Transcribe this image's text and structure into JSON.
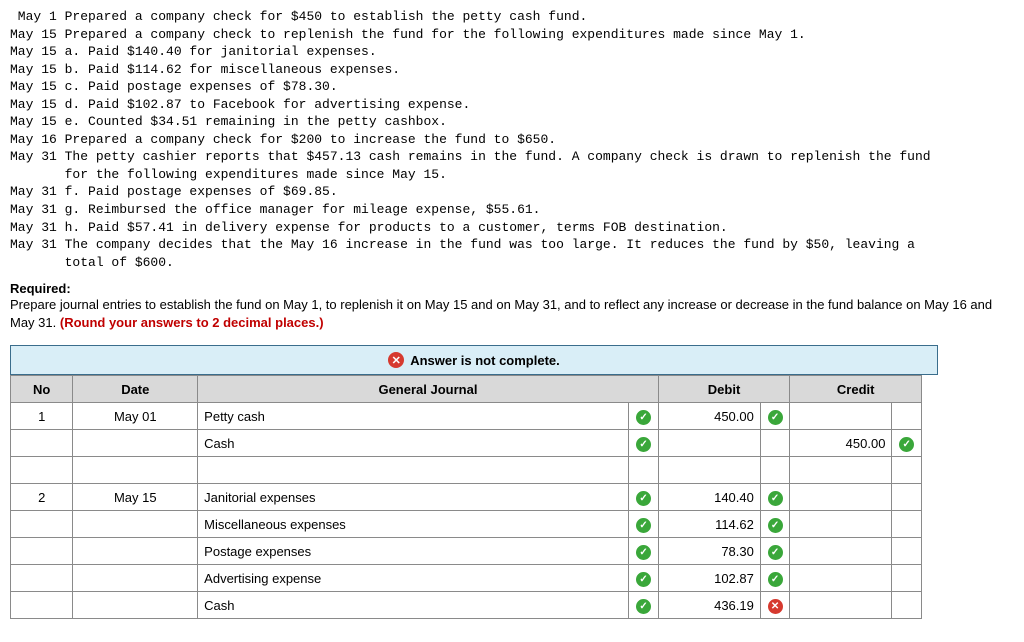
{
  "transactions": [
    " May 1 Prepared a company check for $450 to establish the petty cash fund.",
    "May 15 Prepared a company check to replenish the fund for the following expenditures made since May 1.",
    "May 15 a. Paid $140.40 for janitorial expenses.",
    "May 15 b. Paid $114.62 for miscellaneous expenses.",
    "May 15 c. Paid postage expenses of $78.30.",
    "May 15 d. Paid $102.87 to Facebook for advertising expense.",
    "May 15 e. Counted $34.51 remaining in the petty cashbox.",
    "May 16 Prepared a company check for $200 to increase the fund to $650.",
    "May 31 The petty cashier reports that $457.13 cash remains in the fund. A company check is drawn to replenish the fund",
    "       for the following expenditures made since May 15.",
    "May 31 f. Paid postage expenses of $69.85.",
    "May 31 g. Reimbursed the office manager for mileage expense, $55.61.",
    "May 31 h. Paid $57.41 in delivery expense for products to a customer, terms FOB destination.",
    "May 31 The company decides that the May 16 increase in the fund was too large. It reduces the fund by $50, leaving a",
    "       total of $600."
  ],
  "required_label": "Required:",
  "required_text_a": "Prepare journal entries to establish the fund on May 1, to replenish it on May 15 and on May 31, and to reflect any increase or decrease in the fund balance on May 16 and May 31. ",
  "required_text_b": "(Round your answers to 2 decimal places.)",
  "banner_text": "Answer is not complete.",
  "headers": {
    "no": "No",
    "date": "Date",
    "gj": "General Journal",
    "debit": "Debit",
    "credit": "Credit"
  },
  "rows": [
    {
      "no": "1",
      "date": "May 01",
      "desc": "Petty cash",
      "indent": false,
      "mark": "chk",
      "debit": "450.00",
      "dmark": "chk",
      "credit": "",
      "cmark": ""
    },
    {
      "no": "",
      "date": "",
      "desc": "Cash",
      "indent": true,
      "mark": "chk",
      "debit": "",
      "dmark": "",
      "credit": "450.00",
      "cmark": "chk"
    },
    {
      "no": "",
      "date": "",
      "desc": "",
      "indent": false,
      "mark": "",
      "debit": "",
      "dmark": "",
      "credit": "",
      "cmark": ""
    },
    {
      "no": "2",
      "date": "May 15",
      "desc": "Janitorial expenses",
      "indent": false,
      "mark": "chk",
      "debit": "140.40",
      "dmark": "chk",
      "credit": "",
      "cmark": ""
    },
    {
      "no": "",
      "date": "",
      "desc": "Miscellaneous expenses",
      "indent": false,
      "mark": "chk",
      "debit": "114.62",
      "dmark": "chk",
      "credit": "",
      "cmark": ""
    },
    {
      "no": "",
      "date": "",
      "desc": "Postage expenses",
      "indent": false,
      "mark": "chk",
      "debit": "78.30",
      "dmark": "chk",
      "credit": "",
      "cmark": ""
    },
    {
      "no": "",
      "date": "",
      "desc": "Advertising expense",
      "indent": false,
      "mark": "chk",
      "debit": "102.87",
      "dmark": "chk",
      "credit": "",
      "cmark": ""
    },
    {
      "no": "",
      "date": "",
      "desc": "Cash",
      "indent": false,
      "mark": "chk",
      "debit": "436.19",
      "dmark": "bad",
      "credit": "",
      "cmark": ""
    }
  ]
}
